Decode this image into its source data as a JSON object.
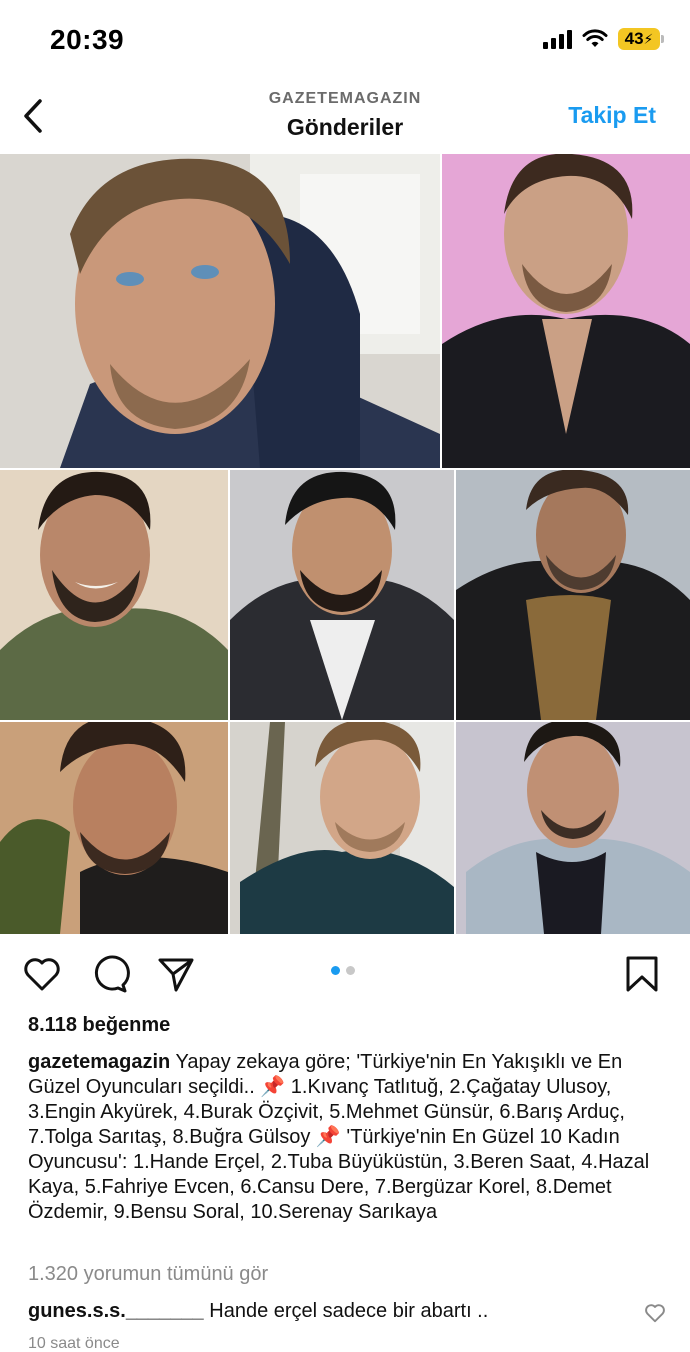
{
  "status_bar": {
    "time": "20:39",
    "battery": "43",
    "icons": [
      "signal-icon",
      "wifi-icon",
      "battery-charging-icon"
    ]
  },
  "nav": {
    "account": "GAZETEMAGAZIN",
    "title": "Gönderiler",
    "follow_label": "Takip Et",
    "back_icon": "chevron-left-icon"
  },
  "post": {
    "photos": [
      "portrait-1",
      "portrait-2",
      "portrait-3",
      "portrait-4",
      "portrait-5",
      "portrait-6",
      "portrait-7",
      "portrait-8"
    ],
    "carousel": {
      "current": 1,
      "total": 2
    },
    "actions": [
      "heart-icon",
      "comment-icon",
      "share-icon",
      "bookmark-icon"
    ],
    "likes": "8.118 beğenme",
    "caption_user": "gazetemagazin",
    "caption_text": "Yapay zekaya göre; 'Türkiye'nin En Yakışıklı ve En Güzel Oyuncuları seçildi.. 📌 1.Kıvanç Tatlıtuğ, 2.Çağatay Ulusoy, 3.Engin Akyürek, 4.Burak Özçivit, 5.Mehmet Günsür, 6.Barış Arduç, 7.Tolga Sarıtaş, 8.Buğra Gülsoy 📌 'Türkiye'nin En Güzel 10 Kadın Oyuncusu': 1.Hande Erçel, 2.Tuba Büyüküstün, 3.Beren Saat, 4.Hazal Kaya, 5.Fahriye Evcen, 6.Cansu Dere, 7.Bergüzar Korel, 8.Demet Özdemir, 9.Bensu Soral, 10.Serenay Sarıkaya",
    "view_comments": "1.320 yorumun tümünü gör",
    "comment_user": "gunes.s.s._______",
    "comment_text": "Hande erçel sadece bir abartı ..",
    "time_ago": "10 saat önce",
    "colors": {
      "accent": "#1a9bf0",
      "muted": "#8a8a8a"
    }
  }
}
